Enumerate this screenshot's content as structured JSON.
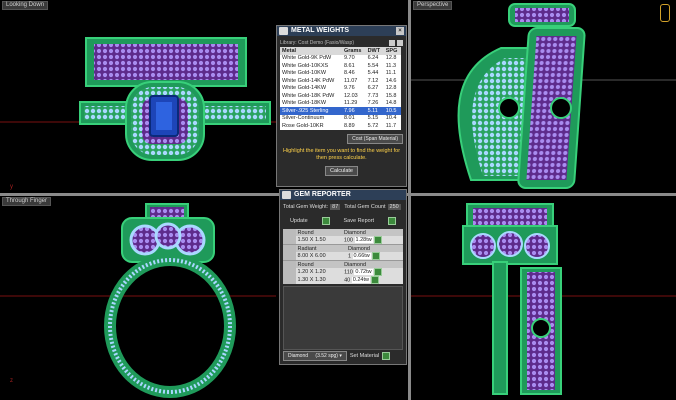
{
  "viewports": {
    "top_left_label": "Looking Down",
    "top_right_label": "Perspective",
    "bottom_left_label": "Through Finger",
    "bottom_right_label": ""
  },
  "metal_weights": {
    "title": "METAL WEIGHTS",
    "library_label": "Library: Cost Demo (Fasio/Wasp)",
    "columns": [
      "Metal",
      "Grams",
      "DWT",
      "SPG"
    ],
    "rows": [
      {
        "metal": "White Gold-9K PdW",
        "grams": "9.70",
        "dwt": "6.24",
        "spg": "12.8"
      },
      {
        "metal": "White Gold-10KXS",
        "grams": "8.61",
        "dwt": "5.54",
        "spg": "11.3"
      },
      {
        "metal": "White Gold-10KW",
        "grams": "8.46",
        "dwt": "5.44",
        "spg": "11.1"
      },
      {
        "metal": "White Gold-14K PdW",
        "grams": "11.07",
        "dwt": "7.12",
        "spg": "14.6"
      },
      {
        "metal": "White Gold-14KW",
        "grams": "9.76",
        "dwt": "6.27",
        "spg": "12.8"
      },
      {
        "metal": "White Gold-18K PdW",
        "grams": "12.03",
        "dwt": "7.73",
        "spg": "15.8"
      },
      {
        "metal": "White Gold-18KW",
        "grams": "11.29",
        "dwt": "7.26",
        "spg": "14.8"
      },
      {
        "metal": "Silver-.925 Sterling",
        "grams": "7.96",
        "dwt": "5.11",
        "spg": "10.5"
      },
      {
        "metal": "Silver-Continuum",
        "grams": "8.01",
        "dwt": "5.15",
        "spg": "10.4"
      },
      {
        "metal": "Rose Gold-10KR",
        "grams": "8.89",
        "dwt": "5.72",
        "spg": "11.7"
      }
    ],
    "selected_index": 7,
    "dropdown_value": "Cost (Span Material)",
    "instruction": "Highlight the item you want to find the weight for then press calculate.",
    "calculate_label": "Calculate"
  },
  "gem_reporter": {
    "title": "GEM REPORTER",
    "total_weight_label": "Total Gem Weight:",
    "total_weight_value": "87",
    "total_count_label": "Total Gem Count",
    "total_count_value": "250",
    "update_label": "Update",
    "save_report_label": "Save Report",
    "groups": [
      {
        "shape": "Round",
        "material": "Diamond",
        "lines": [
          {
            "size": "1.50 X 1.50",
            "count": "100",
            "weight": "1.28tw"
          }
        ]
      },
      {
        "shape": "Radiant",
        "material": "Diamond",
        "lines": [
          {
            "size": "8.00 X 6.00",
            "count": "1",
            "weight": "0.66tw"
          }
        ]
      },
      {
        "shape": "Round",
        "material": "Diamond",
        "lines": [
          {
            "size": "1.20 X 1.20",
            "count": "110",
            "weight": "0.72tw"
          },
          {
            "size": "1.30 X 1.30",
            "count": "40",
            "weight": "0.24tw"
          }
        ]
      }
    ],
    "material_select_value": "Diamond",
    "material_select_spg": "(3.52 spg)",
    "set_material_label": "Set Material"
  }
}
